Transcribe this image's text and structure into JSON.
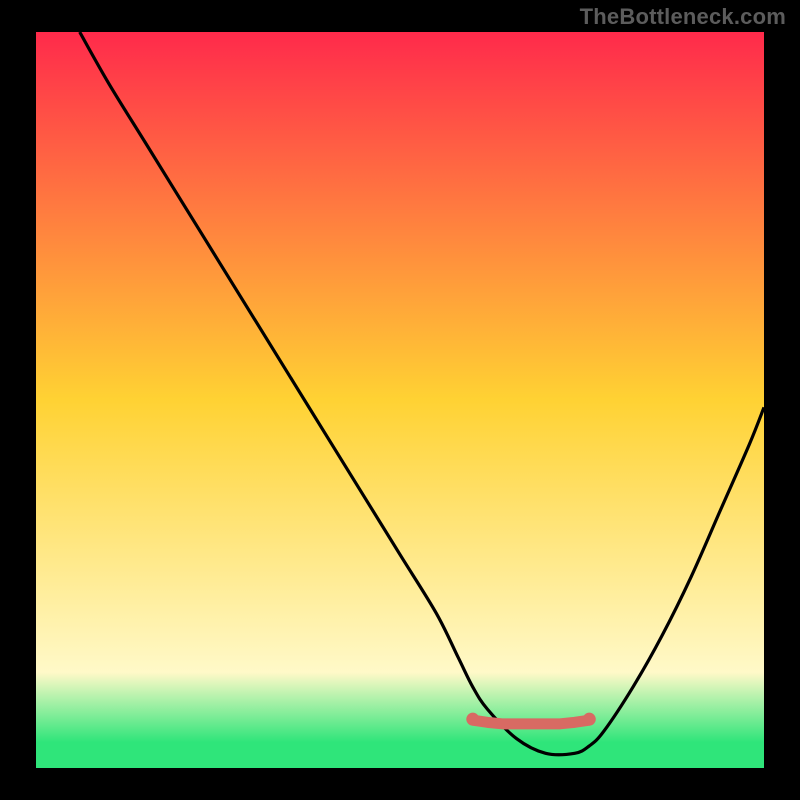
{
  "watermark": "TheBottleneck.com",
  "colors": {
    "background": "#000000",
    "curve": "#000000",
    "marker": "#d86a63",
    "marker_stroke": "#d86a63",
    "gradient_top": "#ff2a4b",
    "gradient_mid": "#ffd233",
    "gradient_yellowlight": "#fff9c8",
    "gradient_green": "#2fe57a",
    "watermark_color": "#5c5c5c"
  },
  "layout": {
    "inner_x": 36,
    "inner_y": 32,
    "inner_w": 728,
    "inner_h": 736
  },
  "chart_data": {
    "type": "line",
    "title": "",
    "xlabel": "",
    "ylabel": "",
    "xlim": [
      0,
      100
    ],
    "ylim": [
      0,
      100
    ],
    "series": [
      {
        "name": "curve",
        "x": [
          6,
          10,
          15,
          20,
          25,
          30,
          35,
          40,
          45,
          50,
          55,
          58,
          60,
          62,
          66,
          70,
          74,
          76,
          78,
          82,
          86,
          90,
          94,
          98,
          100
        ],
        "y": [
          100,
          93,
          85,
          77,
          69,
          61,
          53,
          45,
          37,
          29,
          21,
          15,
          11,
          8,
          4,
          2,
          2,
          3,
          5,
          11,
          18,
          26,
          35,
          44,
          49
        ]
      }
    ],
    "markers": {
      "name": "bottom-band",
      "x": [
        60,
        62,
        64,
        66,
        68,
        70,
        72,
        74,
        76
      ],
      "y": [
        6.5,
        6.2,
        6.0,
        6.0,
        6.0,
        6.0,
        6.0,
        6.2,
        6.5
      ]
    },
    "gradient_stops": [
      {
        "offset": 0.0,
        "key": "gradient_top"
      },
      {
        "offset": 0.5,
        "key": "gradient_mid"
      },
      {
        "offset": 0.87,
        "key": "gradient_yellowlight"
      },
      {
        "offset": 0.965,
        "key": "gradient_green"
      },
      {
        "offset": 1.0,
        "key": "gradient_green"
      }
    ]
  }
}
